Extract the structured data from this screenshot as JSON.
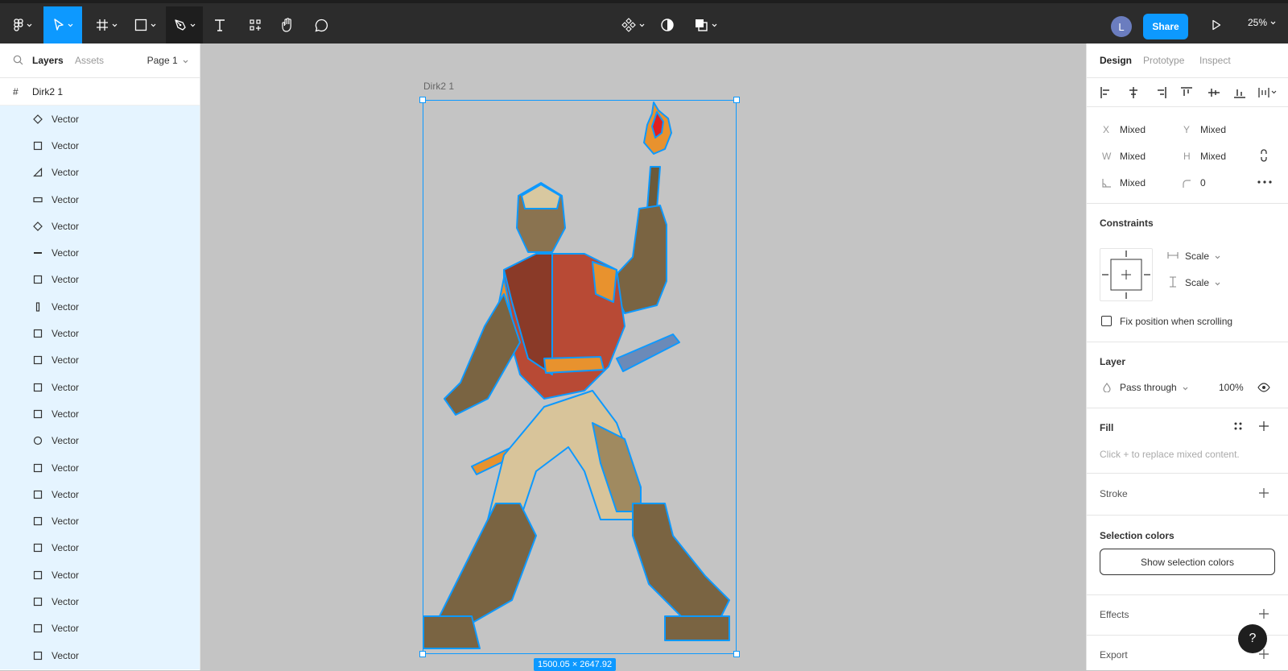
{
  "toolbar": {
    "share_label": "Share",
    "avatar_initial": "L",
    "zoom_label": "25%"
  },
  "left_panel": {
    "tabs": [
      "Layers",
      "Assets"
    ],
    "page_label": "Page 1",
    "frame_name": "Dirk2 1",
    "layers": [
      {
        "label": "Vector",
        "icon": "diamond-icon"
      },
      {
        "label": "Vector",
        "icon": "square-icon"
      },
      {
        "label": "Vector",
        "icon": "triangle-icon"
      },
      {
        "label": "Vector",
        "icon": "wide-rect-icon"
      },
      {
        "label": "Vector",
        "icon": "diamond-icon"
      },
      {
        "label": "Vector",
        "icon": "line-icon"
      },
      {
        "label": "Vector",
        "icon": "square-icon"
      },
      {
        "label": "Vector",
        "icon": "vertical-bar-icon"
      },
      {
        "label": "Vector",
        "icon": "square-icon"
      },
      {
        "label": "Vector",
        "icon": "square-icon"
      },
      {
        "label": "Vector",
        "icon": "square-icon"
      },
      {
        "label": "Vector",
        "icon": "square-icon"
      },
      {
        "label": "Vector",
        "icon": "circle-icon"
      },
      {
        "label": "Vector",
        "icon": "square-icon"
      },
      {
        "label": "Vector",
        "icon": "square-icon"
      },
      {
        "label": "Vector",
        "icon": "square-icon"
      },
      {
        "label": "Vector",
        "icon": "square-icon"
      },
      {
        "label": "Vector",
        "icon": "square-icon"
      },
      {
        "label": "Vector",
        "icon": "square-icon"
      },
      {
        "label": "Vector",
        "icon": "square-icon"
      },
      {
        "label": "Vector",
        "icon": "square-icon"
      }
    ]
  },
  "canvas": {
    "frame_label": "Dirk2 1",
    "dimensions": "1500.05 × 2647.92"
  },
  "right_panel": {
    "tabs": [
      "Design",
      "Prototype",
      "Inspect"
    ],
    "x_label": "X",
    "x_value": "Mixed",
    "y_label": "Y",
    "y_value": "Mixed",
    "w_label": "W",
    "w_value": "Mixed",
    "h_label": "H",
    "h_value": "Mixed",
    "rotation_value": "Mixed",
    "radius_value": "0",
    "constraints_title": "Constraints",
    "constraint_h": "Scale",
    "constraint_v": "Scale",
    "fix_position_label": "Fix position when scrolling",
    "layer_title": "Layer",
    "blend_mode": "Pass through",
    "opacity": "100%",
    "fill_title": "Fill",
    "fill_hint": "Click + to replace mixed content.",
    "stroke_title": "Stroke",
    "selection_colors_title": "Selection colors",
    "show_selection_colors": "Show selection colors",
    "effects_title": "Effects",
    "export_title": "Export"
  },
  "help_label": "?",
  "colors": {
    "accent": "#0d99ff",
    "toolbar": "#2c2c2c",
    "canvas": "#c4c4c4",
    "layer_highlight": "#e5f4ff"
  }
}
